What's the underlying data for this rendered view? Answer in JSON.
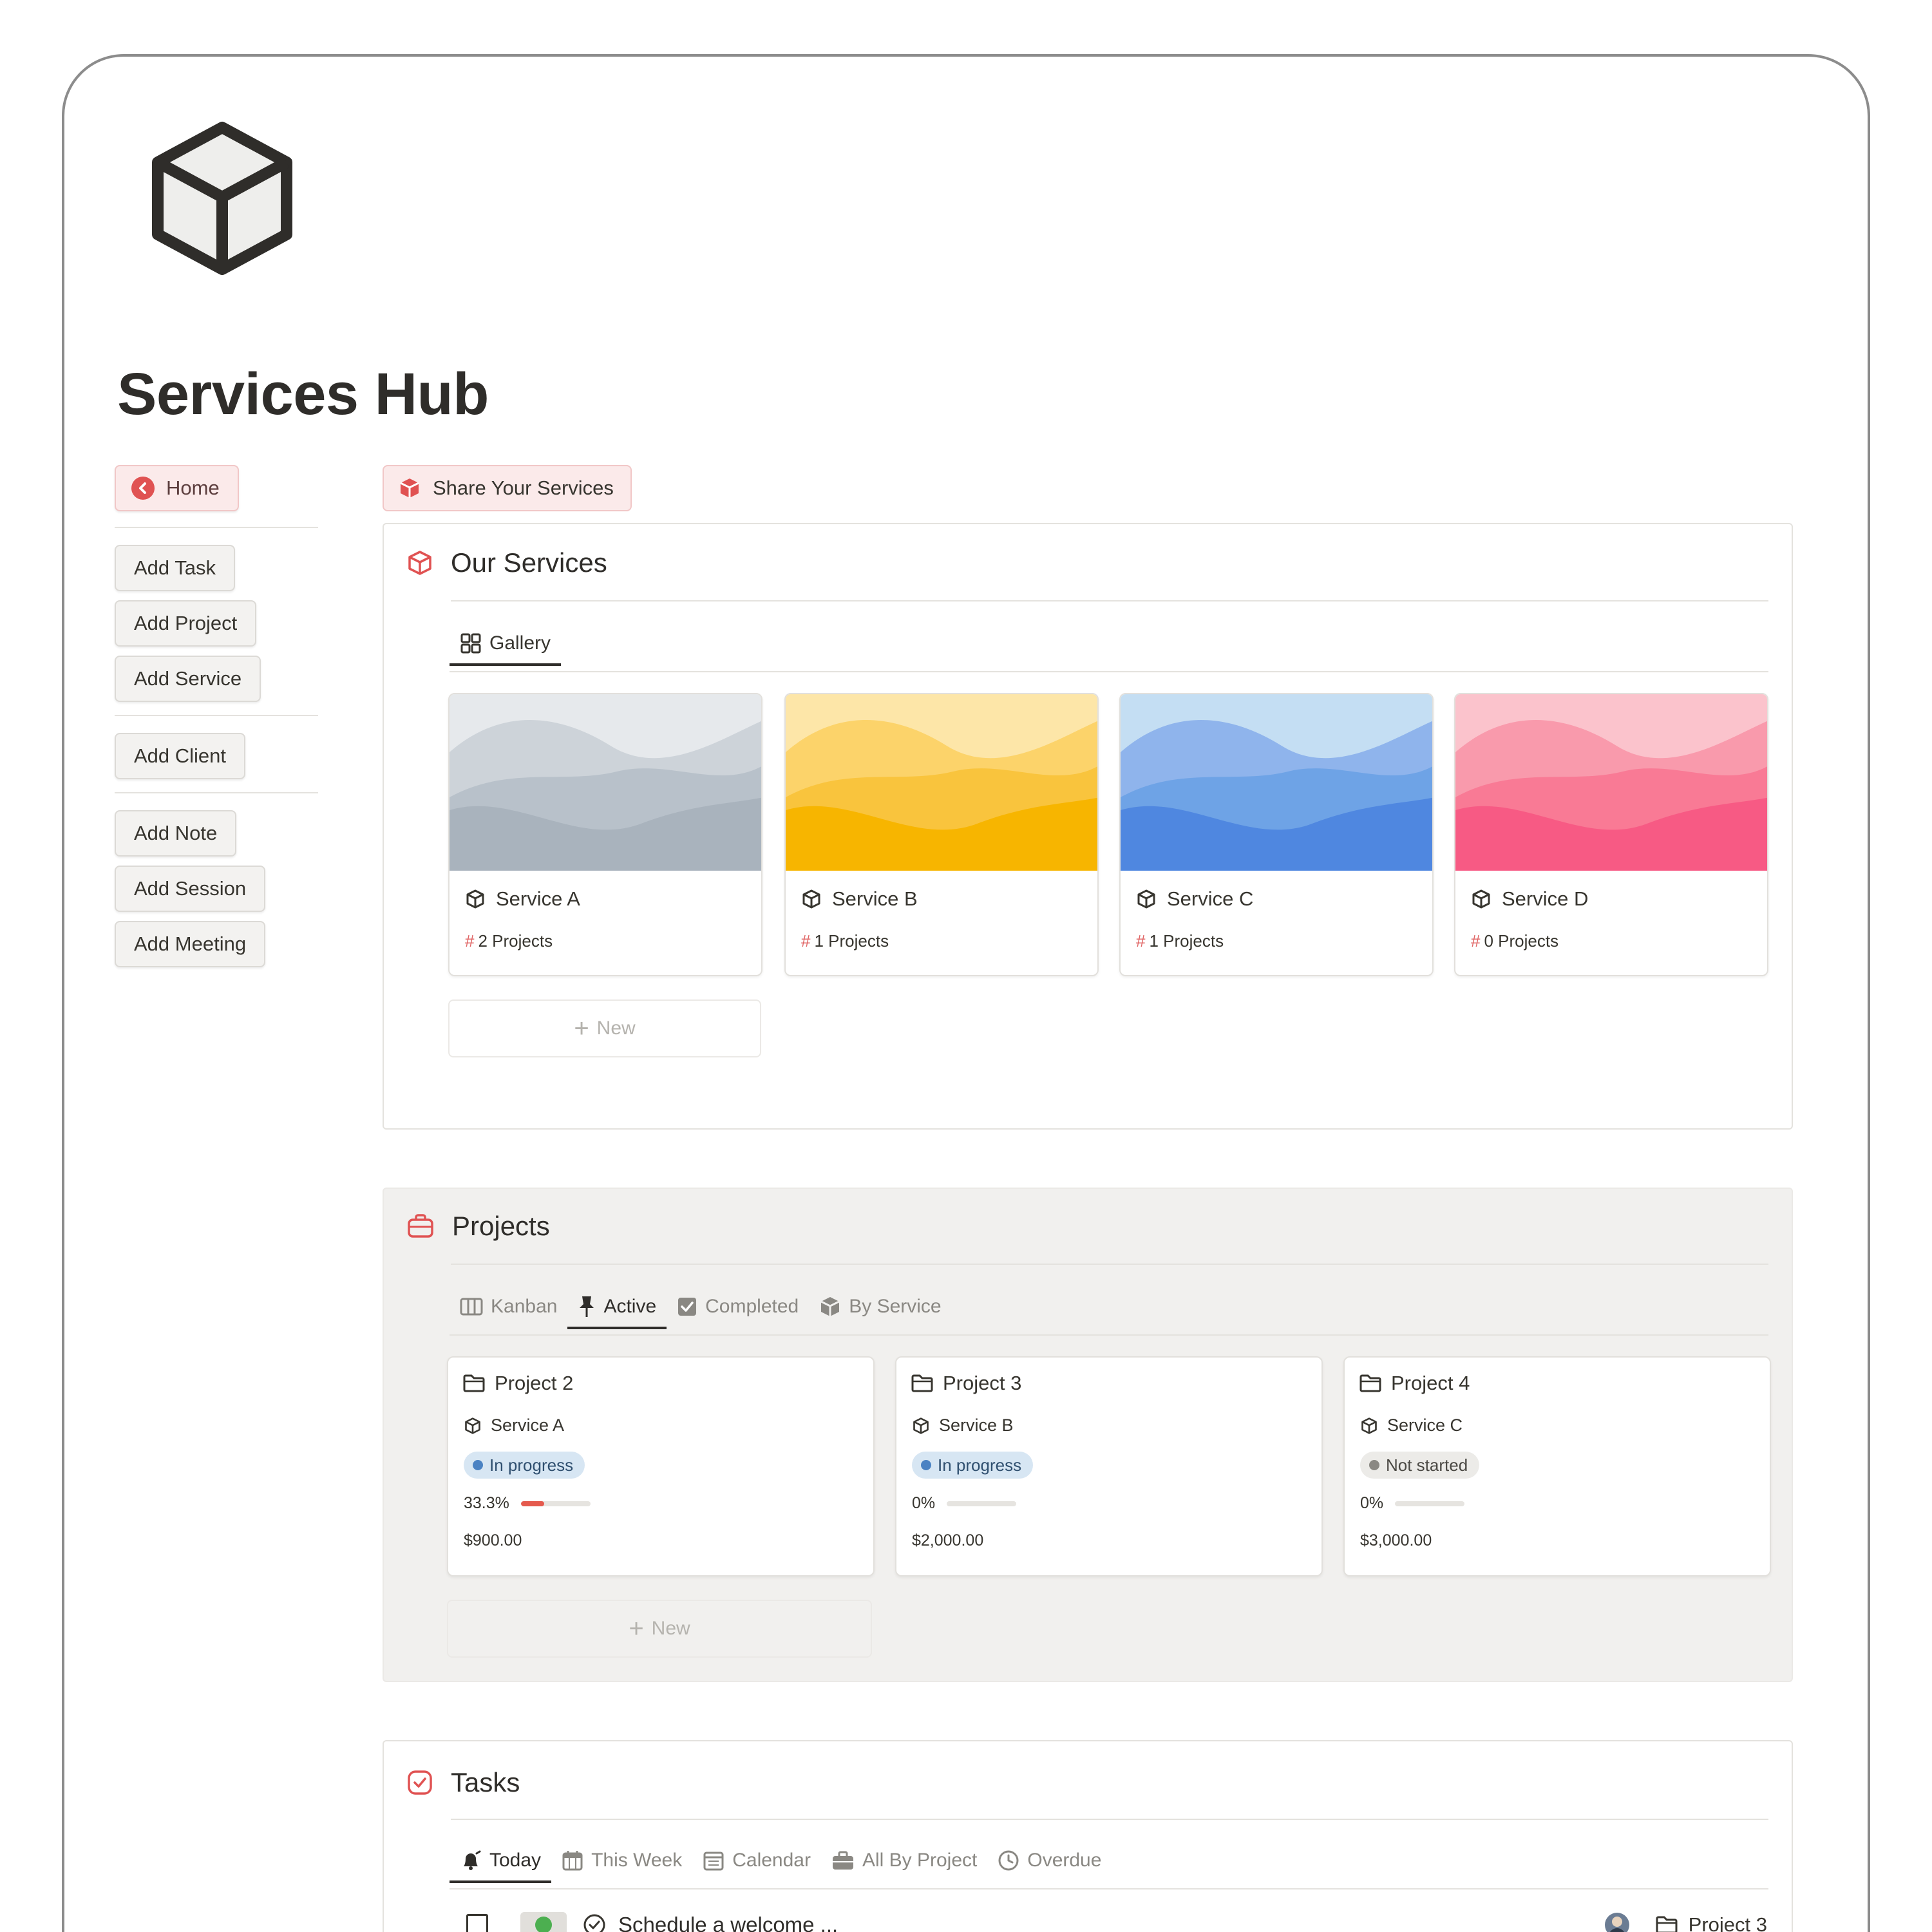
{
  "page": {
    "title": "Services Hub"
  },
  "sidebar": {
    "home": "Home",
    "buttons": [
      "Add Task",
      "Add Project",
      "Add Service",
      "Add Client",
      "Add Note",
      "Add Session",
      "Add Meeting"
    ]
  },
  "share_button": "Share Your Services",
  "services": {
    "title": "Our Services",
    "view_tab": "Gallery",
    "cards": [
      {
        "name": "Service A",
        "projects": "2 Projects",
        "palette": [
          "#e6e9ec",
          "#cdd3d9",
          "#b8c1ca",
          "#a9b3bd"
        ]
      },
      {
        "name": "Service B",
        "projects": "1 Projects",
        "palette": [
          "#fde6a8",
          "#fcd36a",
          "#f9c43d",
          "#f7b500"
        ]
      },
      {
        "name": "Service C",
        "projects": "1 Projects",
        "palette": [
          "#c4def3",
          "#8fb4ec",
          "#6ea3e6",
          "#4f87e0"
        ]
      },
      {
        "name": "Service D",
        "projects": "0 Projects",
        "palette": [
          "#fbc3cc",
          "#f99aac",
          "#f97a95",
          "#f75a84"
        ]
      }
    ],
    "new_label": "New"
  },
  "projects": {
    "title": "Projects",
    "tabs": [
      {
        "label": "Kanban",
        "icon": "kanban-icon"
      },
      {
        "label": "Active",
        "icon": "pin-icon"
      },
      {
        "label": "Completed",
        "icon": "checkbox-icon"
      },
      {
        "label": "By Service",
        "icon": "box-icon"
      }
    ],
    "active_tab": "Active",
    "cards": [
      {
        "name": "Project 2",
        "service": "Service A",
        "status": "In progress",
        "progress_label": "33.3%",
        "progress": 0.333,
        "price": "$900.00"
      },
      {
        "name": "Project 3",
        "service": "Service B",
        "status": "In progress",
        "progress_label": "0%",
        "progress": 0,
        "price": "$2,000.00"
      },
      {
        "name": "Project 4",
        "service": "Service C",
        "status": "Not started",
        "progress_label": "0%",
        "progress": 0,
        "price": "$3,000.00"
      }
    ],
    "new_label": "New",
    "status_colors": {
      "in_progress": {
        "bg": "#d7e6f3",
        "dot": "#4a82c3",
        "text": "#2f4f6f"
      },
      "not_started": {
        "bg": "#ecebe8",
        "dot": "#8a8883",
        "text": "#4a4843"
      }
    }
  },
  "tasks": {
    "title": "Tasks",
    "tabs": [
      {
        "label": "Today",
        "icon": "bell-icon"
      },
      {
        "label": "This Week",
        "icon": "calendar-week-icon"
      },
      {
        "label": "Calendar",
        "icon": "calendar-icon"
      },
      {
        "label": "All By Project",
        "icon": "briefcase-icon"
      },
      {
        "label": "Overdue",
        "icon": "clock-icon"
      }
    ],
    "active_tab": "Today",
    "rows": [
      {
        "title": "Schedule a welcome ...",
        "project": "Project 3"
      }
    ]
  },
  "colors": {
    "accent_red": "#e05252",
    "text": "#37352f",
    "muted": "#8a8883"
  }
}
